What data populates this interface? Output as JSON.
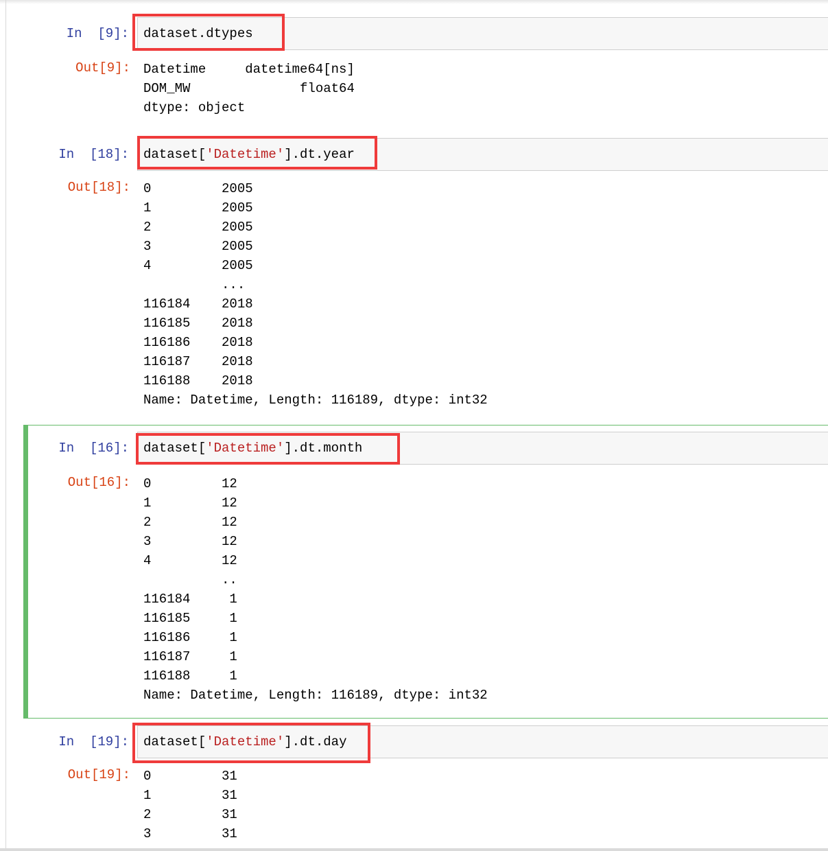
{
  "cells": [
    {
      "in_prompt": "In  [9]:",
      "code_pre": "dataset.dtypes",
      "code_str": "",
      "code_post": "",
      "out_prompt": "Out[9]:",
      "output": "Datetime     datetime64[ns]\nDOM_MW              float64\ndtype: object"
    },
    {
      "in_prompt": "In  [18]:",
      "code_pre": "dataset[",
      "code_str": "'Datetime'",
      "code_post": "].dt.year",
      "out_prompt": "Out[18]:",
      "output": "0         2005\n1         2005\n2         2005\n3         2005\n4         2005\n          ...\n116184    2018\n116185    2018\n116186    2018\n116187    2018\n116188    2018\nName: Datetime, Length: 116189, dtype: int32"
    },
    {
      "in_prompt": "In  [16]:",
      "code_pre": "dataset[",
      "code_str": "'Datetime'",
      "code_post": "].dt.month",
      "out_prompt": "Out[16]:",
      "output": "0         12\n1         12\n2         12\n3         12\n4         12\n          ..\n116184     1\n116185     1\n116186     1\n116187     1\n116188     1\nName: Datetime, Length: 116189, dtype: int32"
    },
    {
      "in_prompt": "In  [19]:",
      "code_pre": "dataset[",
      "code_str": "'Datetime'",
      "code_post": "].dt.day",
      "out_prompt": "Out[19]:",
      "output": "0         31\n1         31\n2         31\n3         31"
    }
  ],
  "colors": {
    "in_prompt": "#303f9f",
    "out_prompt": "#d84315",
    "string": "#ba2121",
    "highlight_box": "#ef3b3b",
    "selected_border": "#66bb6a"
  }
}
